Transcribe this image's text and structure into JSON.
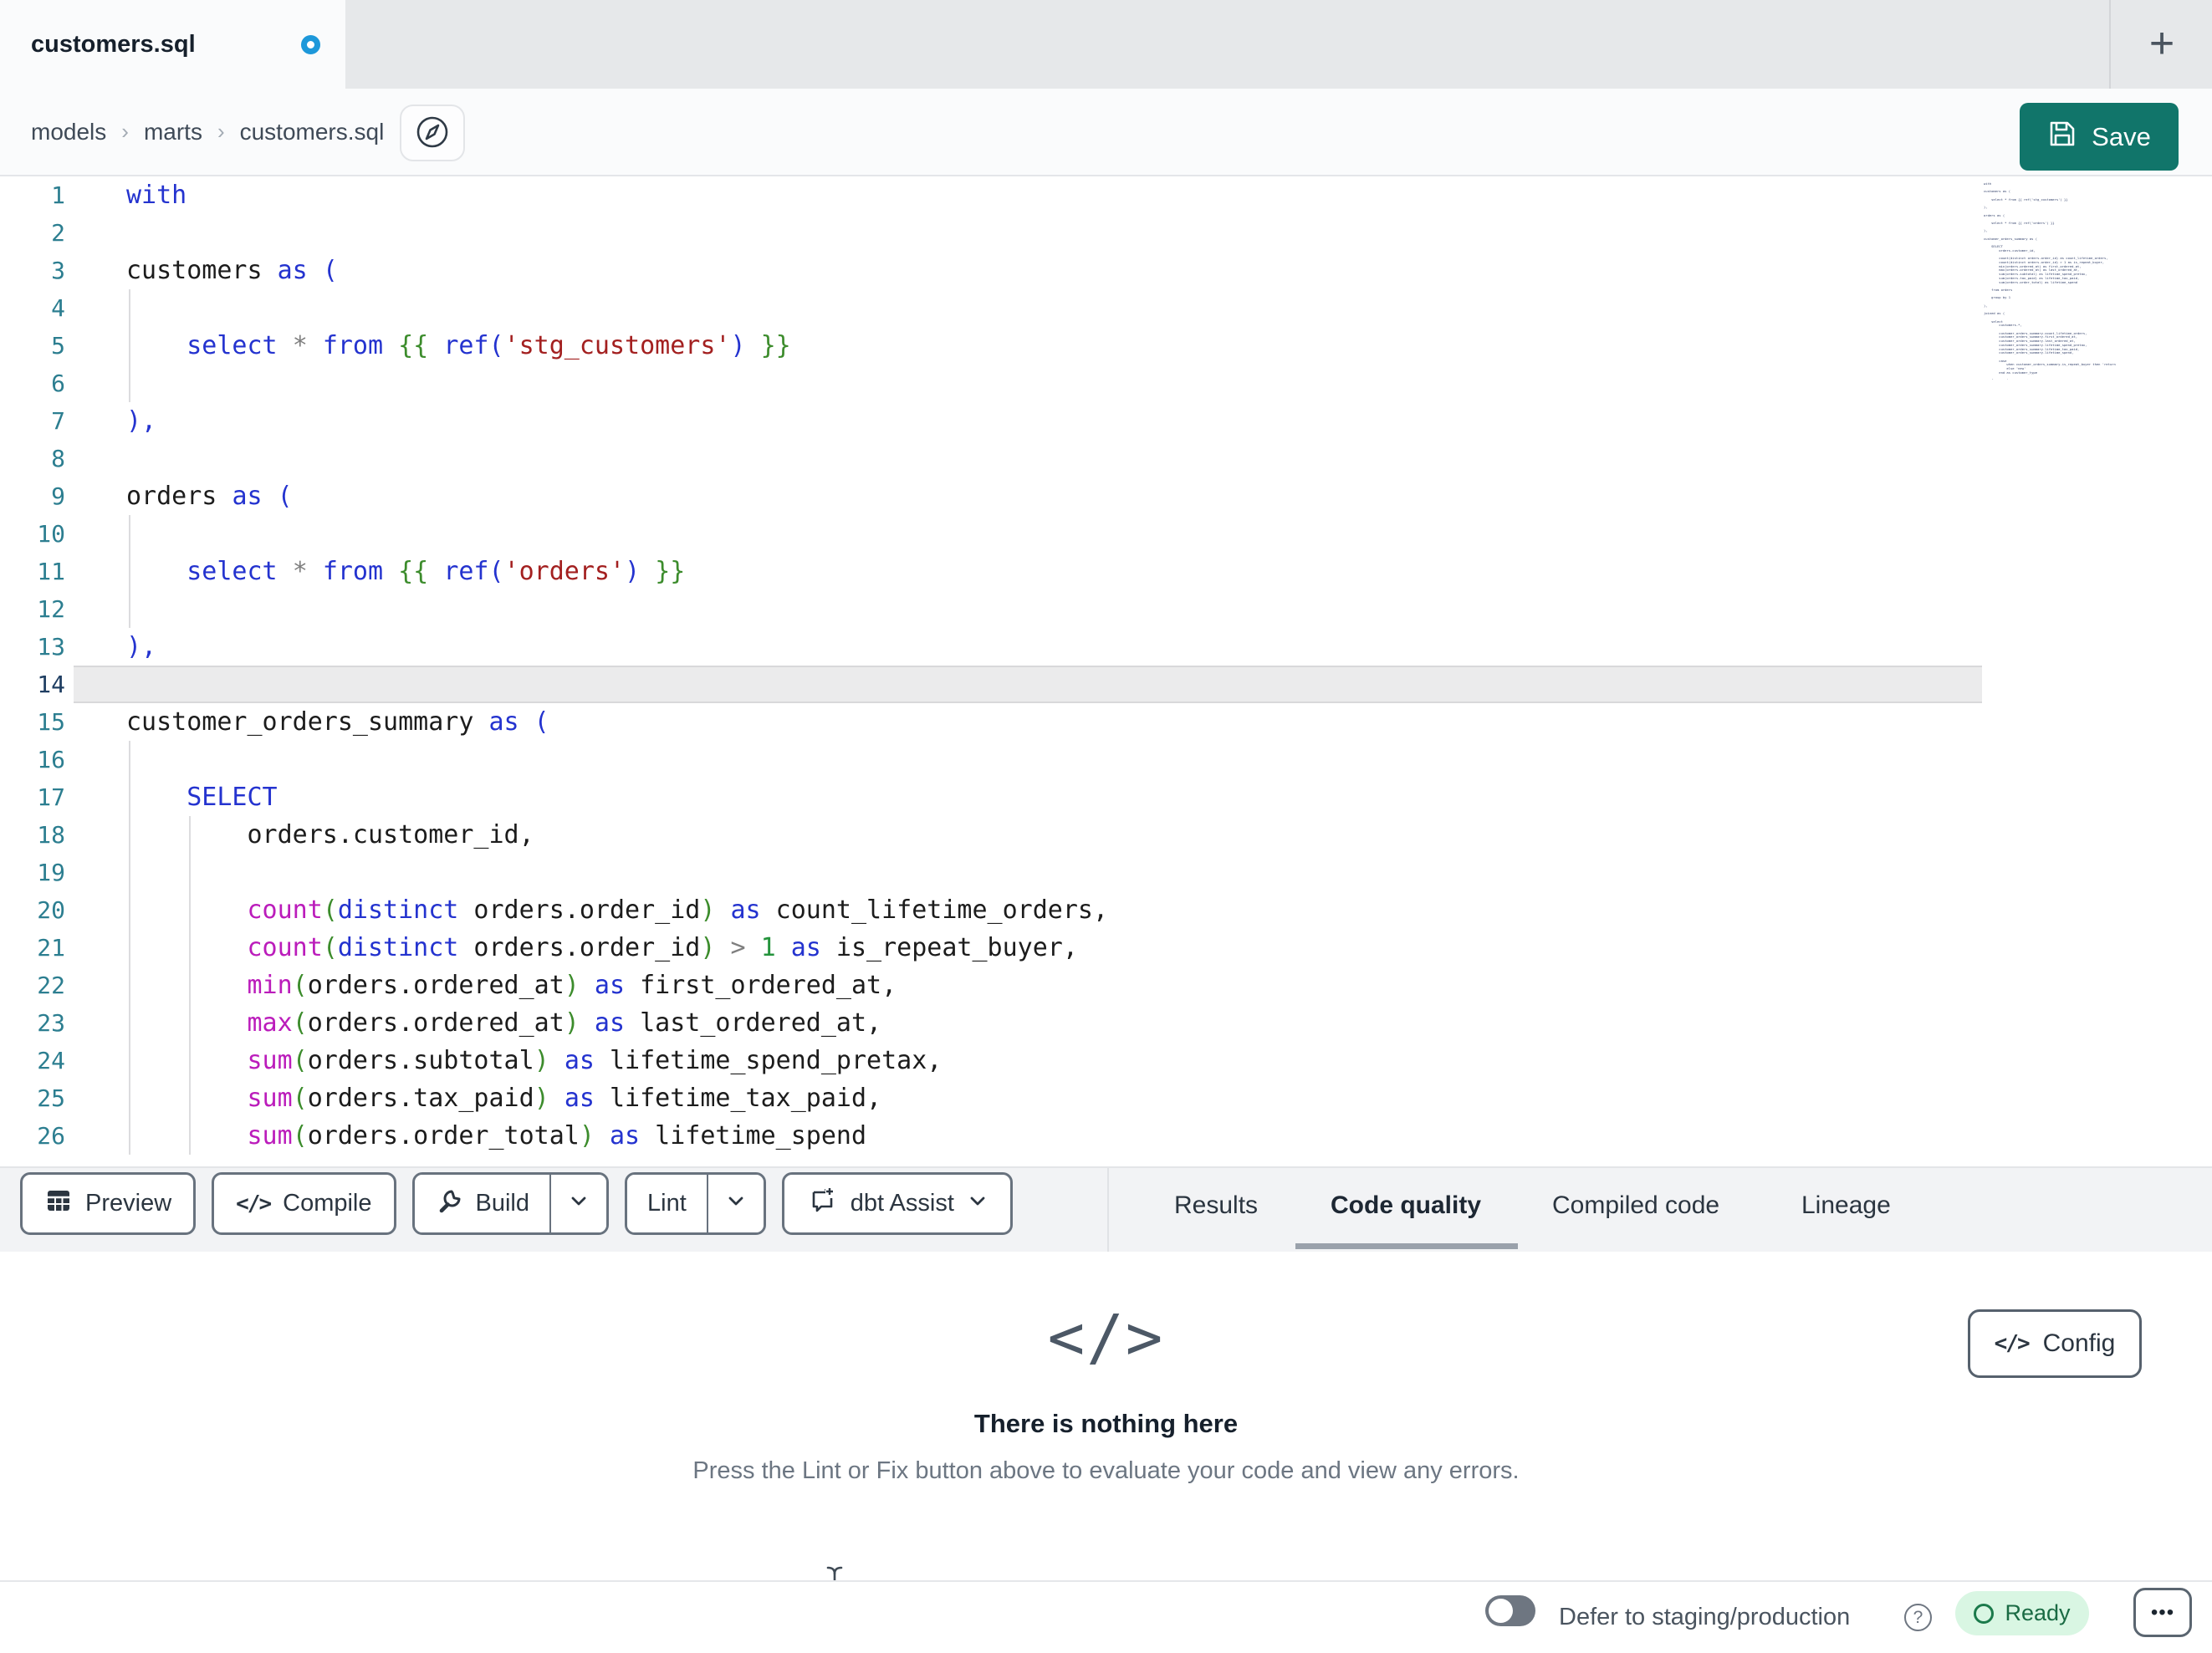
{
  "tab_bar": {
    "active_tab_title": "customers.sql",
    "new_tab_label": "+"
  },
  "breadcrumb": {
    "items": [
      "models",
      "marts",
      "customers.sql"
    ],
    "separator": "›"
  },
  "actions": {
    "save_label": "Save"
  },
  "icons": {
    "code_glyph": "</>"
  },
  "editor": {
    "active_line": 14,
    "lines": [
      {
        "n": "1",
        "t": [
          [
            "kw",
            "with"
          ]
        ]
      },
      {
        "n": "2",
        "t": []
      },
      {
        "n": "3",
        "t": [
          [
            "id",
            "customers "
          ],
          [
            "kw",
            "as"
          ],
          [
            "id",
            " "
          ],
          [
            "p1",
            "("
          ]
        ]
      },
      {
        "n": "4",
        "t": [],
        "g": [
          0
        ]
      },
      {
        "n": "5",
        "t": [
          [
            "id",
            "    "
          ],
          [
            "kw",
            "select"
          ],
          [
            "id",
            " "
          ],
          [
            "op",
            "*"
          ],
          [
            "id",
            " "
          ],
          [
            "kw",
            "from"
          ],
          [
            "id",
            " "
          ],
          [
            "jj",
            "{{"
          ],
          [
            "id",
            " "
          ],
          [
            "kw",
            "ref"
          ],
          [
            "p1",
            "("
          ],
          [
            "str",
            "'stg_customers'"
          ],
          [
            "p1",
            ")"
          ],
          [
            "id",
            " "
          ],
          [
            "jj",
            "}}"
          ]
        ],
        "g": [
          0
        ]
      },
      {
        "n": "6",
        "t": [],
        "g": [
          0
        ]
      },
      {
        "n": "7",
        "t": [
          [
            "p1",
            "),"
          ]
        ]
      },
      {
        "n": "8",
        "t": []
      },
      {
        "n": "9",
        "t": [
          [
            "id",
            "orders "
          ],
          [
            "kw",
            "as"
          ],
          [
            "id",
            " "
          ],
          [
            "p1",
            "("
          ]
        ]
      },
      {
        "n": "10",
        "t": [],
        "g": [
          0
        ]
      },
      {
        "n": "11",
        "t": [
          [
            "id",
            "    "
          ],
          [
            "kw",
            "select"
          ],
          [
            "id",
            " "
          ],
          [
            "op",
            "*"
          ],
          [
            "id",
            " "
          ],
          [
            "kw",
            "from"
          ],
          [
            "id",
            " "
          ],
          [
            "jj",
            "{{"
          ],
          [
            "id",
            " "
          ],
          [
            "kw",
            "ref"
          ],
          [
            "p1",
            "("
          ],
          [
            "str",
            "'orders'"
          ],
          [
            "p1",
            ")"
          ],
          [
            "id",
            " "
          ],
          [
            "jj",
            "}}"
          ]
        ],
        "g": [
          0
        ]
      },
      {
        "n": "12",
        "t": [],
        "g": [
          0
        ]
      },
      {
        "n": "13",
        "t": [
          [
            "p1",
            "),"
          ]
        ]
      },
      {
        "n": "14",
        "t": [],
        "active": true
      },
      {
        "n": "15",
        "t": [
          [
            "id",
            "customer_orders_summary "
          ],
          [
            "kw",
            "as"
          ],
          [
            "id",
            " "
          ],
          [
            "p1",
            "("
          ]
        ]
      },
      {
        "n": "16",
        "t": [],
        "g": [
          0
        ]
      },
      {
        "n": "17",
        "t": [
          [
            "id",
            "    "
          ],
          [
            "kw",
            "SELECT"
          ]
        ],
        "g": [
          0
        ]
      },
      {
        "n": "18",
        "t": [
          [
            "id",
            "        orders.customer_id,"
          ]
        ],
        "g": [
          0,
          1
        ]
      },
      {
        "n": "19",
        "t": [],
        "g": [
          0,
          1
        ]
      },
      {
        "n": "20",
        "t": [
          [
            "id",
            "        "
          ],
          [
            "fn",
            "count"
          ],
          [
            "p2",
            "("
          ],
          [
            "kw",
            "distinct"
          ],
          [
            "id",
            " orders.order_id"
          ],
          [
            "p2",
            ")"
          ],
          [
            "id",
            " "
          ],
          [
            "kw",
            "as"
          ],
          [
            "id",
            " count_lifetime_orders,"
          ]
        ],
        "g": [
          0,
          1
        ]
      },
      {
        "n": "21",
        "t": [
          [
            "id",
            "        "
          ],
          [
            "fn",
            "count"
          ],
          [
            "p2",
            "("
          ],
          [
            "kw",
            "distinct"
          ],
          [
            "id",
            " orders.order_id"
          ],
          [
            "p2",
            ")"
          ],
          [
            "id",
            " "
          ],
          [
            "op",
            ">"
          ],
          [
            "id",
            " "
          ],
          [
            "num",
            "1"
          ],
          [
            "id",
            " "
          ],
          [
            "kw",
            "as"
          ],
          [
            "id",
            " is_repeat_buyer,"
          ]
        ],
        "g": [
          0,
          1
        ]
      },
      {
        "n": "22",
        "t": [
          [
            "id",
            "        "
          ],
          [
            "fn",
            "min"
          ],
          [
            "p2",
            "("
          ],
          [
            "id",
            "orders.ordered_at"
          ],
          [
            "p2",
            ")"
          ],
          [
            "id",
            " "
          ],
          [
            "kw",
            "as"
          ],
          [
            "id",
            " first_ordered_at,"
          ]
        ],
        "g": [
          0,
          1
        ]
      },
      {
        "n": "23",
        "t": [
          [
            "id",
            "        "
          ],
          [
            "fn",
            "max"
          ],
          [
            "p2",
            "("
          ],
          [
            "id",
            "orders.ordered_at"
          ],
          [
            "p2",
            ")"
          ],
          [
            "id",
            " "
          ],
          [
            "kw",
            "as"
          ],
          [
            "id",
            " last_ordered_at,"
          ]
        ],
        "g": [
          0,
          1
        ]
      },
      {
        "n": "24",
        "t": [
          [
            "id",
            "        "
          ],
          [
            "fn",
            "sum"
          ],
          [
            "p2",
            "("
          ],
          [
            "id",
            "orders.subtotal"
          ],
          [
            "p2",
            ")"
          ],
          [
            "id",
            " "
          ],
          [
            "kw",
            "as"
          ],
          [
            "id",
            " lifetime_spend_pretax,"
          ]
        ],
        "g": [
          0,
          1
        ]
      },
      {
        "n": "25",
        "t": [
          [
            "id",
            "        "
          ],
          [
            "fn",
            "sum"
          ],
          [
            "p2",
            "("
          ],
          [
            "id",
            "orders.tax_paid"
          ],
          [
            "p2",
            ")"
          ],
          [
            "id",
            " "
          ],
          [
            "kw",
            "as"
          ],
          [
            "id",
            " lifetime_tax_paid,"
          ]
        ],
        "g": [
          0,
          1
        ]
      },
      {
        "n": "26",
        "t": [
          [
            "id",
            "        "
          ],
          [
            "fn",
            "sum"
          ],
          [
            "p2",
            "("
          ],
          [
            "id",
            "orders.order_total"
          ],
          [
            "p2",
            ")"
          ],
          [
            "id",
            " "
          ],
          [
            "kw",
            "as"
          ],
          [
            "id",
            " lifetime_spend"
          ]
        ],
        "g": [
          0,
          1
        ]
      }
    ],
    "minimap_code": "with\n\ncustomers as (\n\n    select * from {{ ref('stg_customers') }}\n\n),\n\norders as (\n\n    select * from {{ ref('orders') }}\n\n),\n\ncustomer_orders_summary as (\n\n    SELECT\n        orders.customer_id,\n\n        count(distinct orders.order_id) as count_lifetime_orders,\n        count(distinct orders.order_id) > 1 as is_repeat_buyer,\n        min(orders.ordered_at) as first_ordered_at,\n        max(orders.ordered_at) as last_ordered_at,\n        sum(orders.subtotal) as lifetime_spend_pretax,\n        sum(orders.tax_paid) as lifetime_tax_paid,\n        sum(orders.order_total) as lifetime_spend\n\n    from orders\n\n    group by 1\n\n),\n\njoined as (\n\n    select\n        customers.*,\n\n        customer_orders_summary.count_lifetime_orders,\n        customer_orders_summary.first_ordered_at,\n        customer_orders_summary.last_ordered_at,\n        customer_orders_summary.lifetime_spend_pretax,\n        customer_orders_summary.lifetime_tax_paid,\n        customer_orders_summary.lifetime_spend,\n\n        case\n            when customer_orders_summary.is_repeat_buyer then 'returning'\n            else 'new'\n        end as customer_type\n\n    from customers\n\n    left join customer_orders_summary\n        on customers.customer_id = customer_orders_summary.customer_id\n\n)\n\nselect * from joined"
  },
  "toolbar": {
    "preview_label": "Preview",
    "compile_label": "Compile",
    "build_label": "Build",
    "lint_label": "Lint",
    "assist_label": "dbt Assist"
  },
  "results_tabs": {
    "tabs": [
      {
        "label": "Results"
      },
      {
        "label": "Code quality",
        "active": true
      },
      {
        "label": "Compiled code"
      },
      {
        "label": "Lineage"
      }
    ]
  },
  "empty_state": {
    "title": "There is nothing here",
    "subtitle": "Press the Lint or Fix button above to evaluate your code and view any errors.",
    "config_label": "Config"
  },
  "status_bar": {
    "defer_label": "Defer to staging/production",
    "help_label": "?",
    "ready_label": "Ready",
    "more_label": "•••"
  },
  "colors": {
    "accent_teal": "#11756a",
    "unsaved_blue": "#1d98da",
    "ready_bg": "#d9f6e3",
    "ready_green": "#1b7a4b",
    "keyword_blue": "#2433cf",
    "function_magenta": "#bb1cbb",
    "string_red": "#a32020",
    "jinja_green": "#3c8c2c",
    "line_number_teal": "#2c7e90"
  }
}
